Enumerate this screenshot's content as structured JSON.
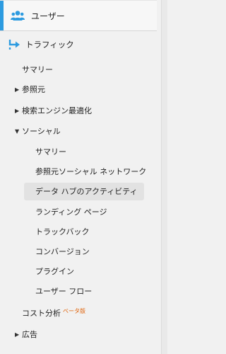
{
  "nav": {
    "users": {
      "label": "ユーザー",
      "icon": "users-icon"
    },
    "traffic": {
      "label": "トラフィック",
      "icon": "traffic-arrow-icon"
    },
    "items": [
      {
        "label": "サマリー"
      },
      {
        "label": "参照元",
        "collapsed": true
      },
      {
        "label": "検索エンジン最適化",
        "collapsed": true
      },
      {
        "label": "ソーシャル",
        "expanded": true
      },
      {
        "label": "サマリー"
      },
      {
        "label": "参照元ソーシャル ネットワーク"
      },
      {
        "label": "データ ハブのアクティビティ",
        "active": true
      },
      {
        "label": "ランディング ページ"
      },
      {
        "label": "トラックバック"
      },
      {
        "label": "コンバージョン"
      },
      {
        "label": "プラグイン"
      },
      {
        "label": "ユーザー フロー"
      },
      {
        "label": "コスト分析",
        "badge": "ベータ版"
      },
      {
        "label": "広告",
        "collapsed": true
      }
    ]
  },
  "colors": {
    "accent": "#2d9be0",
    "badge": "#e0630a",
    "active_bg": "#e2e2e2"
  }
}
